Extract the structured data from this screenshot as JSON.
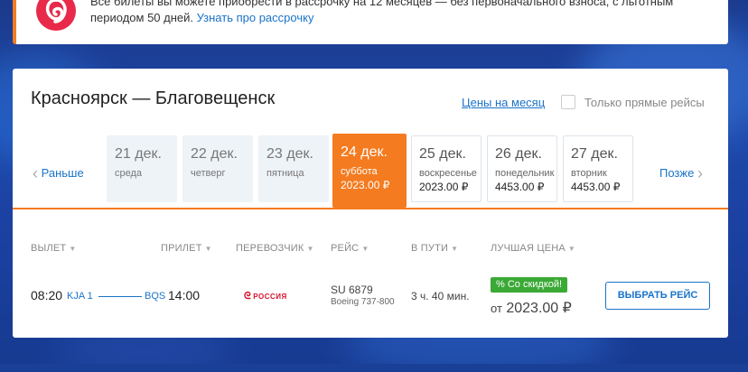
{
  "promo": {
    "text": "Все билеты вы можете приобрести в рассрочку на 12 месяцев — без первоначального взноса, с льготным периодом 50 дней.",
    "link": "Узнать про рассрочку",
    "logo_icon": "brand-logo-icon"
  },
  "search": {
    "route": "Красноярск — Благовещенск",
    "month_link": "Цены на месяц",
    "direct_only_label": "Только прямые рейсы",
    "direct_only_checked": false
  },
  "date_nav": {
    "prev": "Раньше",
    "next": "Позже",
    "dates": [
      {
        "day": "21 дек.",
        "weekday": "среда",
        "price": "",
        "state": "past"
      },
      {
        "day": "22 дек.",
        "weekday": "четверг",
        "price": "",
        "state": "past"
      },
      {
        "day": "23 дек.",
        "weekday": "пятница",
        "price": "",
        "state": "past"
      },
      {
        "day": "24 дек.",
        "weekday": "суббота",
        "price": "2023.00 ₽",
        "state": "active"
      },
      {
        "day": "25 дек.",
        "weekday": "воскресенье",
        "price": "2023.00 ₽",
        "state": "available"
      },
      {
        "day": "26 дек.",
        "weekday": "понедельник",
        "price": "4453.00 ₽",
        "state": "available"
      },
      {
        "day": "27 дек.",
        "weekday": "вторник",
        "price": "4453.00 ₽",
        "state": "available"
      }
    ]
  },
  "columns": {
    "departure": "ВЫЛЕТ",
    "arrival": "ПРИЛЕТ",
    "carrier": "ПЕРЕВОЗЧИК",
    "flight": "РЕЙС",
    "duration": "В ПУТИ",
    "best_price": "ЛУЧШАЯ ЦЕНА"
  },
  "flight": {
    "dep_time": "08:20",
    "dep_code": "KJA 1",
    "arr_code": "BQS",
    "arr_time": "14:00",
    "carrier": "РОССИЯ",
    "flight_no": "SU 6879",
    "aircraft": "Boeing 737-800",
    "duration": "3 ч. 40 мин.",
    "badge": "% Со скидкой!",
    "price_prefix": "от",
    "price": "2023.00 ₽",
    "select_button": "ВЫБРАТЬ РЕЙС"
  },
  "colors": {
    "accent": "#f47b20",
    "link": "#1a73c8",
    "sale": "#3aa935",
    "brand": "#e8294a",
    "background": "#1d47a8"
  }
}
